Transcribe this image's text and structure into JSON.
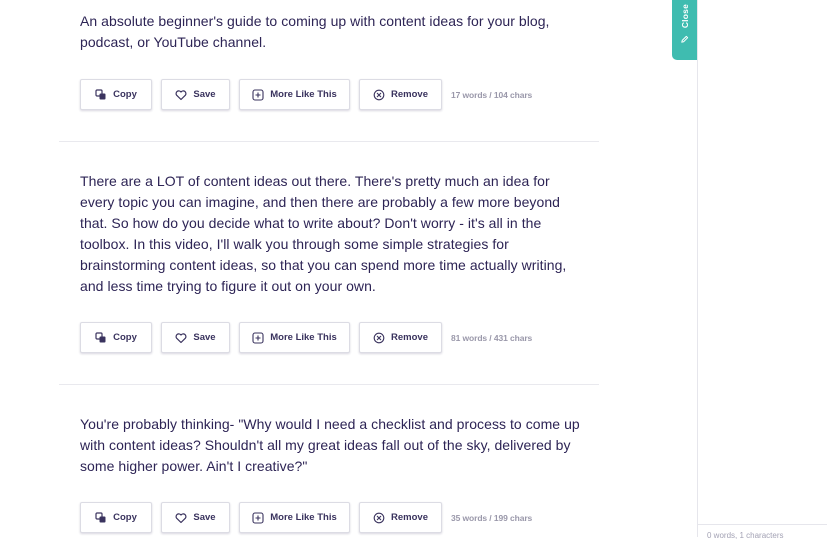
{
  "results": [
    {
      "text": "An absolute beginner's guide to coming up with content ideas for your blog, podcast, or YouTube channel.",
      "count": "17 words / 104 chars"
    },
    {
      "text": "There are a LOT of content ideas out there. There's pretty much an idea for every topic you can imagine, and then there are probably a few more beyond that. So how do you decide what to write about? Don't worry - it's all in the toolbox. In this video, I'll walk you through some simple strategies for brainstorming content ideas, so that you can spend more time actually writing, and less time trying to figure it out on your own.",
      "count": "81 words / 431 chars"
    },
    {
      "text": "You're probably thinking- \"Why would I need a checklist and process to come up with content ideas? Shouldn't all my great ideas fall out of the sky, delivered by some higher power. Ain't I creative?\"",
      "count": "35 words / 199 chars"
    }
  ],
  "actions": {
    "copy": "Copy",
    "save": "Save",
    "more": "More Like This",
    "remove": "Remove"
  },
  "close_tab": {
    "label": "Close",
    "icon": "pencil-icon"
  },
  "editor": {
    "status": "0 words, 1 characters"
  },
  "colors": {
    "text": "#2d2455",
    "accent_teal": "#3fbcb0",
    "muted": "#9a98aa",
    "border": "#dcdce4"
  }
}
